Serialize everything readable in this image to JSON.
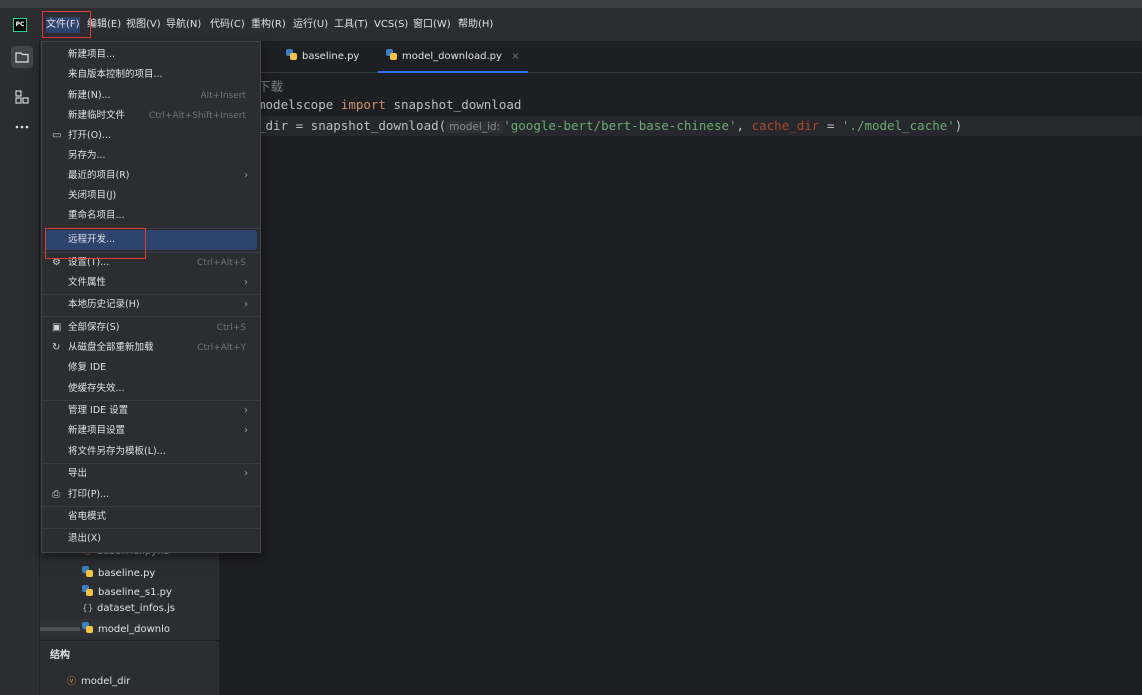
{
  "menubar": {
    "items": [
      "文件(F)",
      "编辑(E)",
      "视图(V)",
      "导航(N)",
      "代码(C)",
      "重构(R)",
      "运行(U)",
      "工具(T)",
      "VCS(S)",
      "窗口(W)",
      "帮助(H)"
    ],
    "logo": "PC"
  },
  "tabs": [
    {
      "label": "baseline.py"
    },
    {
      "label": "model_download.py",
      "close": "×"
    }
  ],
  "code": {
    "line1_tail": "下载",
    "line2_rest": "modelscope ",
    "line2_kw": "import",
    "line2_tail": " snapshot_download",
    "line3_head": "_dir = snapshot_download(",
    "line3_hint": "model_id:",
    "line3_str1": "'google-bert/bert-base-chinese'",
    "line3_comma": ", ",
    "line3_kwarg": "cache_dir",
    "line3_eq": " = ",
    "line3_str2": "'./model_cache'",
    "line3_end": ")"
  },
  "file_menu": {
    "items": [
      {
        "label": "新建项目..."
      },
      {
        "label": "来自版本控制的项目..."
      },
      {
        "label": "新建(N)...",
        "shortcut": "Alt+Insert"
      },
      {
        "label": "新建临时文件",
        "shortcut": "Ctrl+Alt+Shift+Insert"
      },
      {
        "label": "打开(O)...",
        "icon": "folder-icon"
      },
      {
        "label": "另存为..."
      },
      {
        "label": "最近的项目(R)",
        "submenu": true
      },
      {
        "label": "关闭项目(J)"
      },
      {
        "label": "重命名项目..."
      },
      {
        "label": "远程开发...",
        "selected": true
      },
      {
        "label": "设置(T)...",
        "shortcut": "Ctrl+Alt+S",
        "icon": "gear-icon"
      },
      {
        "label": "文件属性",
        "submenu": true
      },
      {
        "label": "本地历史记录(H)",
        "submenu": true
      },
      {
        "label": "全部保存(S)",
        "shortcut": "Ctrl+S",
        "icon": "save-icon"
      },
      {
        "label": "从磁盘全部重新加载",
        "shortcut": "Ctrl+Alt+Y",
        "icon": "reload-icon"
      },
      {
        "label": "修复 IDE"
      },
      {
        "label": "使缓存失效..."
      },
      {
        "label": "管理 IDE 设置",
        "submenu": true
      },
      {
        "label": "新建项目设置",
        "submenu": true
      },
      {
        "label": "将文件另存为模板(L)..."
      },
      {
        "label": "导出",
        "submenu": true
      },
      {
        "label": "打印(P)...",
        "icon": "print-icon"
      },
      {
        "label": "省电模式"
      },
      {
        "label": "退出(X)"
      }
    ]
  },
  "project_tree": {
    "files": [
      {
        "name": "baseline.ipynb",
        "icon": "notebook-icon"
      },
      {
        "name": "baseline.py",
        "icon": "python-icon"
      },
      {
        "name": "baseline_s1.py",
        "icon": "python-icon"
      },
      {
        "name": "dataset_infos.js",
        "icon": "json-icon"
      },
      {
        "name": "model_downlo",
        "icon": "python-icon"
      }
    ],
    "structure_title": "结构",
    "structure_item": "model_dir"
  },
  "colors": {
    "accent": "#3574f0",
    "selection": "#2e436e",
    "highlight_box": "#e23b3b"
  }
}
